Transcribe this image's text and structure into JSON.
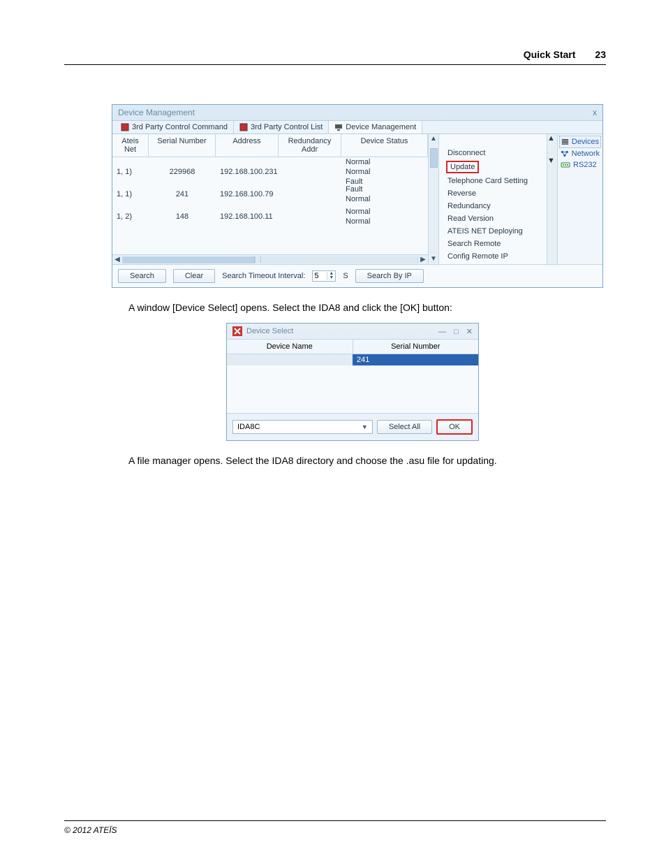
{
  "header": {
    "title": "Quick Start",
    "page": "23"
  },
  "window": {
    "title": "Device Management",
    "close": "x",
    "tabs": [
      "3rd Party Control Command",
      "3rd Party Control List",
      "Device Management"
    ],
    "columns": [
      "Ateis Net",
      "Serial Number",
      "Address",
      "Redundancy Addr",
      "Device Status"
    ],
    "rows": [
      {
        "net": "1, 1)",
        "serial": "229968",
        "addr": "192.168.100.231",
        "statuses": [
          "Normal",
          "Normal",
          "Fault"
        ]
      },
      {
        "net": "1, 1)",
        "serial": "241",
        "addr": "192.168.100.79",
        "statuses": [
          "Fault",
          "Normal"
        ]
      },
      {
        "net": "1, 2)",
        "serial": "148",
        "addr": "192.168.100.11",
        "statuses": [
          "Normal",
          "Normal"
        ]
      }
    ],
    "actions": [
      "Disconnect",
      "Update",
      "Telephone Card Setting",
      "Reverse",
      "Redundancy",
      "Read Version",
      "ATEIS NET Deploying",
      "Search Remote",
      "Config Remote IP"
    ],
    "right_items": [
      "Devices",
      "Network",
      "RS232"
    ],
    "buttons": {
      "search": "Search",
      "clear": "Clear",
      "search_by_ip": "Search By IP"
    },
    "timeout_label": "Search Timeout Interval:",
    "timeout_value": "5",
    "timeout_unit": "S"
  },
  "caption1": "A window [Device Select] opens. Select the IDA8 and click the [OK] button:",
  "dialog": {
    "title": "Device Select",
    "columns": [
      "Device Name",
      "Serial Number"
    ],
    "row": {
      "name": "",
      "serial": "241"
    },
    "combo": "IDA8C",
    "select_all": "Select All",
    "ok": "OK"
  },
  "caption2": "A file manager opens. Select the IDA8 directory and choose the .asu file for updating.",
  "footer": "© 2012 ATEÏS"
}
